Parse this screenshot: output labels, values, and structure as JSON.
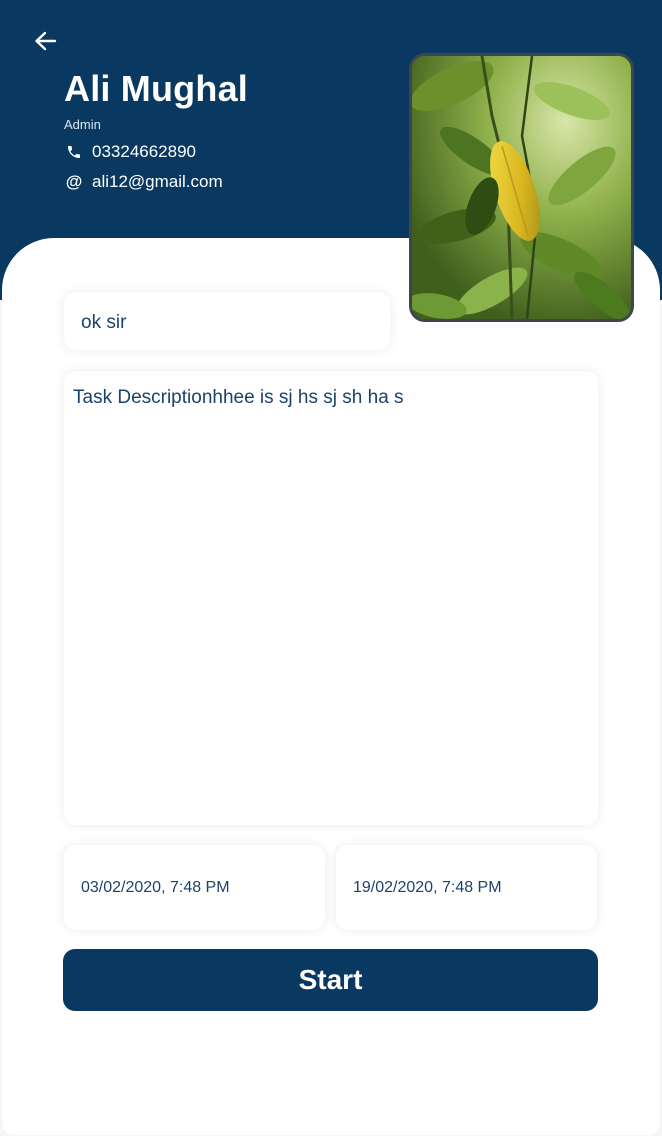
{
  "header": {
    "back_icon": "arrow-left-icon",
    "name": "Ali Mughal",
    "role": "Admin",
    "phone": "03324662890",
    "phone_icon": "phone-icon",
    "email": "ali12@gmail.com",
    "email_icon_glyph": "@",
    "color": "#093860"
  },
  "task": {
    "title_value": "ok sir",
    "description_value": "Task Descriptionhhee is sj hs sj sh ha s",
    "start_date": "03/02/2020, 7:48 PM",
    "end_date": "19/02/2020, 7:48 PM"
  },
  "actions": {
    "start_label": "Start"
  },
  "photo": {
    "subject": "green leaves with a yellow leaf"
  }
}
